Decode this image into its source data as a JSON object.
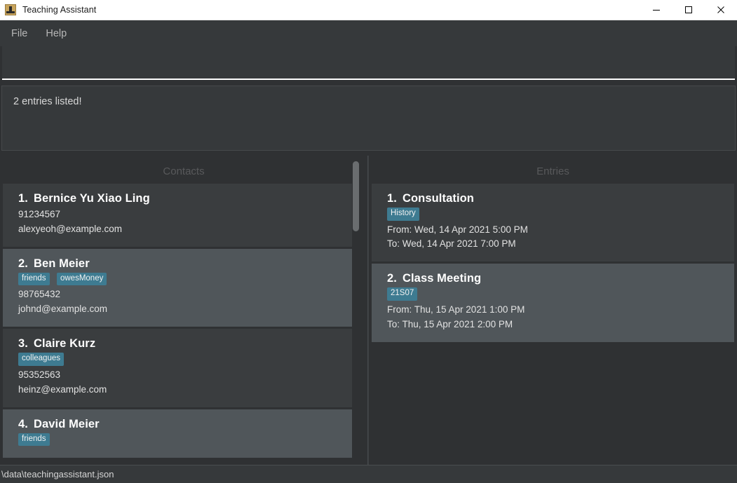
{
  "window": {
    "title": "Teaching Assistant",
    "icon": "app-icon",
    "controls": {
      "minimize": "minimize-icon",
      "maximize": "maximize-icon",
      "close": "close-icon"
    }
  },
  "menubar": {
    "items": [
      {
        "label": "File"
      },
      {
        "label": "Help"
      }
    ]
  },
  "command": {
    "value": "",
    "placeholder": ""
  },
  "result": {
    "text": "2 entries listed!"
  },
  "panels": {
    "contacts": {
      "header": "Contacts",
      "items": [
        {
          "index": "1.",
          "name": "Bernice Yu Xiao Ling",
          "tags": [],
          "phone": "91234567",
          "email": "alexyeoh@example.com"
        },
        {
          "index": "2.",
          "name": "Ben Meier",
          "tags": [
            "friends",
            "owesMoney"
          ],
          "phone": "98765432",
          "email": "johnd@example.com"
        },
        {
          "index": "3.",
          "name": "Claire Kurz",
          "tags": [
            "colleagues"
          ],
          "phone": "95352563",
          "email": "heinz@example.com"
        },
        {
          "index": "4.",
          "name": "David Meier",
          "tags": [
            "friends"
          ],
          "phone": "",
          "email": ""
        }
      ]
    },
    "entries": {
      "header": "Entries",
      "items": [
        {
          "index": "1.",
          "name": "Consultation",
          "tags": [
            "History"
          ],
          "from": "From: Wed, 14 Apr 2021 5:00 PM",
          "to": "To: Wed, 14 Apr 2021 7:00 PM"
        },
        {
          "index": "2.",
          "name": "Class Meeting",
          "tags": [
            "21S07"
          ],
          "from": "From: Thu, 15 Apr 2021 1:00 PM",
          "to": "To: Thu, 15 Apr 2021 2:00 PM"
        }
      ]
    }
  },
  "statusbar": {
    "path": "\\data\\teachingassistant.json"
  },
  "colors": {
    "accent_tag": "#3e7b91",
    "window_bg": "#2f3133",
    "card_base": "#3a3d3f",
    "card_alt": "#50565a",
    "titlebar_bg": "#ffffff",
    "panel_header_text": "#58595b"
  }
}
